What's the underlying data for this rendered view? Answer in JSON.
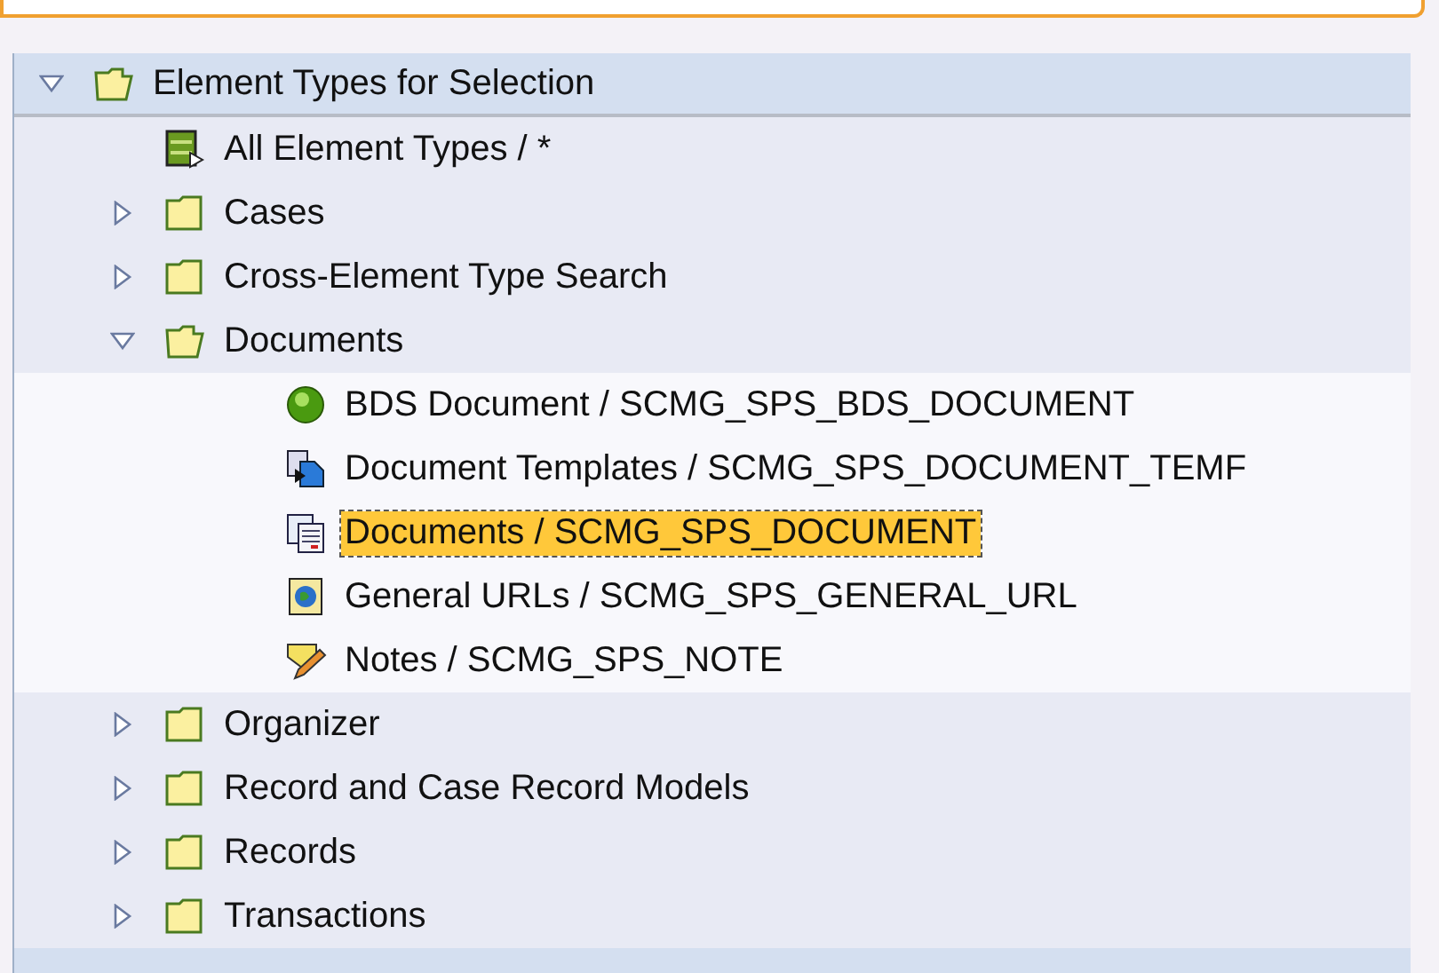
{
  "tree": {
    "label": "Element Types for Selection",
    "kind": "folder",
    "expanded": true,
    "children": [
      {
        "label": "All Element Types / *",
        "kind": "all-types",
        "selected": false
      },
      {
        "label": "Cases",
        "kind": "folder",
        "expanded": false
      },
      {
        "label": "Cross-Element Type Search",
        "kind": "folder",
        "expanded": false
      },
      {
        "label": "Documents",
        "kind": "folder",
        "expanded": true,
        "children": [
          {
            "label": "BDS Document / SCMG_SPS_BDS_DOCUMENT",
            "kind": "ball",
            "selected": false
          },
          {
            "label": "Document Templates / SCMG_SPS_DOCUMENT_TEMF",
            "kind": "template",
            "selected": false
          },
          {
            "label": "Documents / SCMG_SPS_DOCUMENT",
            "kind": "document",
            "selected": true
          },
          {
            "label": "General URLs / SCMG_SPS_GENERAL_URL",
            "kind": "url",
            "selected": false
          },
          {
            "label": "Notes / SCMG_SPS_NOTE",
            "kind": "note",
            "selected": false
          }
        ]
      },
      {
        "label": "Organizer",
        "kind": "folder",
        "expanded": false
      },
      {
        "label": "Record and Case Record Models",
        "kind": "folder",
        "expanded": false
      },
      {
        "label": "Records",
        "kind": "folder",
        "expanded": false
      },
      {
        "label": "Transactions",
        "kind": "folder",
        "expanded": false
      }
    ]
  }
}
